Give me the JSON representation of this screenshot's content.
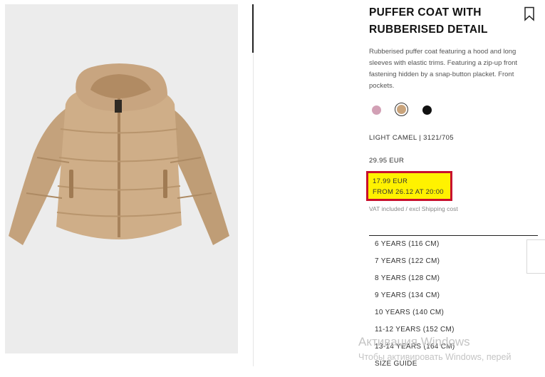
{
  "product": {
    "title_line1": "PUFFER COAT WITH",
    "title_line2": "RUBBERISED DETAIL",
    "description": "Rubberised puffer coat featuring a hood and long sleeves with elastic trims. Featuring a zip-up front fastening hidden by a snap-button placket. Front pockets.",
    "color_ref": "LIGHT CAMEL | 3121/705",
    "image_icon": "puffer-coat-photo"
  },
  "colors": [
    {
      "name": "pink",
      "hex": "#d2a0b5"
    },
    {
      "name": "light-camel",
      "hex": "#c9a47c",
      "selected": true
    },
    {
      "name": "black",
      "hex": "#111111"
    }
  ],
  "pricing": {
    "original": "29.95 EUR",
    "sale": "17.99 EUR",
    "sale_from": "FROM 26.12 AT 20:00",
    "vat_note": "VAT included / excl Shipping cost",
    "highlight_color": "#fff200",
    "highlight_border": "#c8102e"
  },
  "sizes": [
    "6 YEARS (116 CM)",
    "7 YEARS (122 CM)",
    "8 YEARS (128 CM)",
    "9 YEARS (134 CM)",
    "10 YEARS (140 CM)",
    "11-12 YEARS (152 CM)",
    "13-14 YEARS (164 CM)",
    "SIZE GUIDE"
  ],
  "windows_activation": {
    "title": "Активация Windows",
    "subtitle": "Чтобы активировать Windows, перей"
  }
}
